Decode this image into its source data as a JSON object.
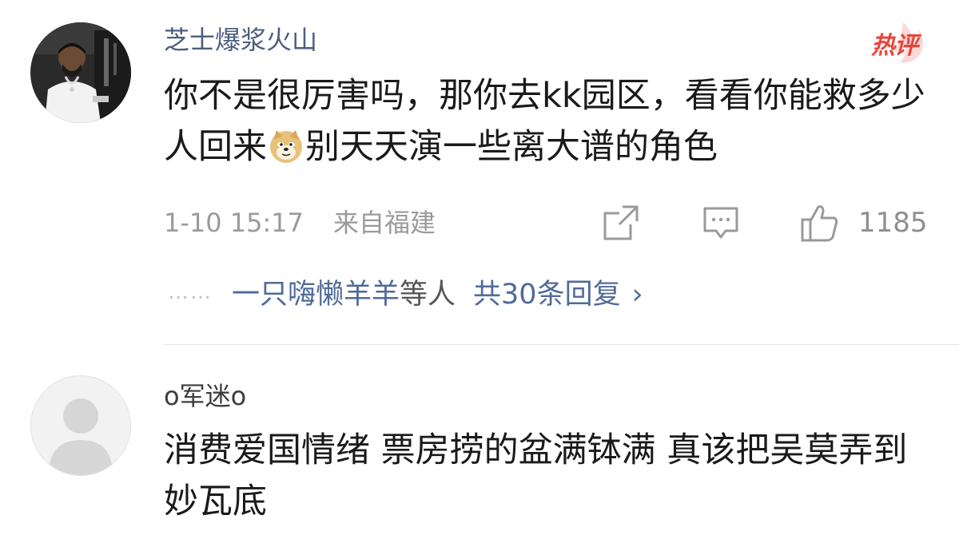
{
  "comments": [
    {
      "username": "芝士爆浆火山",
      "badge": "热评",
      "text_before_emoji": "你不是很厉害吗，那你去kk园区，看看你能救多少人回来",
      "emoji": "doge-emoji",
      "text_after_emoji": "别天天演一些离大谱的角色",
      "time": "1-10 15:17",
      "region": "来自福建",
      "like_count": "1185",
      "replies": {
        "ellipsis": "……",
        "user": "一只嗨懒羊羊",
        "etc": "等人",
        "count_text": "共30条回复",
        "chevron": "›"
      }
    },
    {
      "username": "o军迷o",
      "text": "消费爱国情绪 票房捞的盆满钵满 真该把吴莫弄到妙瓦底"
    }
  ],
  "colors": {
    "username": "#4d5d7e",
    "badge": "#e8453c",
    "meta": "#9a9a9a",
    "reply_link": "#506a99"
  },
  "icons": [
    "share-icon",
    "comment-icon",
    "thumbs-up-icon",
    "chevron-right-icon"
  ]
}
